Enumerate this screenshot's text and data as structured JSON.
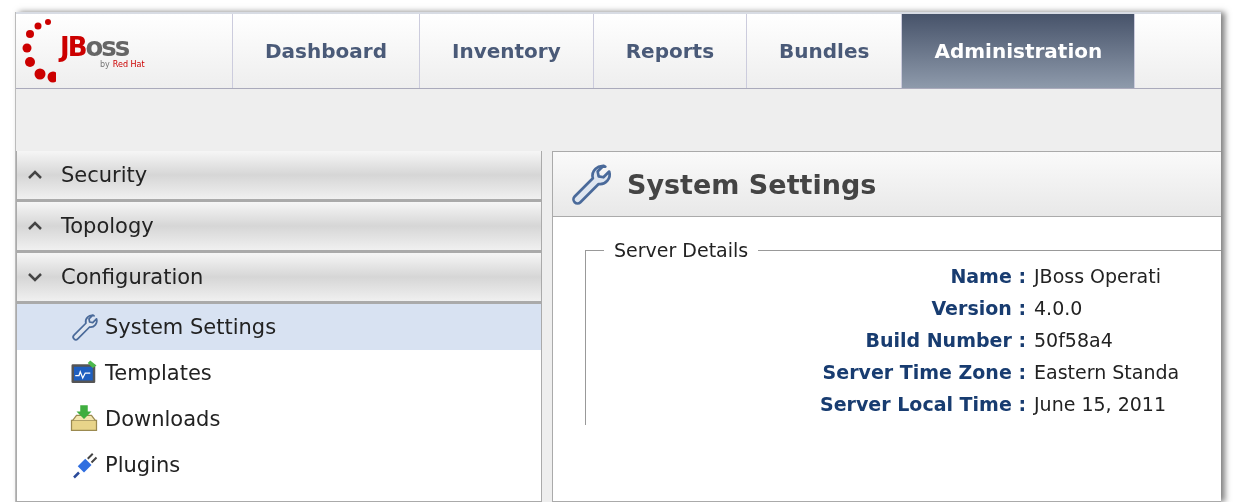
{
  "logo": {
    "name": "JBoss",
    "byline_prefix": "by",
    "byline_brand": "Red Hat"
  },
  "tabs": [
    {
      "label": "Dashboard",
      "selected": false
    },
    {
      "label": "Inventory",
      "selected": false
    },
    {
      "label": "Reports",
      "selected": false
    },
    {
      "label": "Bundles",
      "selected": false
    },
    {
      "label": "Administration",
      "selected": true
    }
  ],
  "sidebar": {
    "sections": [
      {
        "label": "Security",
        "expanded": false
      },
      {
        "label": "Topology",
        "expanded": false
      },
      {
        "label": "Configuration",
        "expanded": true,
        "items": [
          {
            "label": "System Settings",
            "kind": "wrench",
            "selected": true
          },
          {
            "label": "Templates",
            "kind": "monitor",
            "selected": false
          },
          {
            "label": "Downloads",
            "kind": "tray",
            "selected": false
          },
          {
            "label": "Plugins",
            "kind": "plug",
            "selected": false
          }
        ]
      }
    ]
  },
  "panel": {
    "title": "System Settings",
    "fieldset": {
      "legend": "Server Details",
      "rows": [
        {
          "label": "Name :",
          "value": "JBoss Operati"
        },
        {
          "label": "Version :",
          "value": "4.0.0"
        },
        {
          "label": "Build Number :",
          "value": "50f58a4"
        },
        {
          "label": "Server Time Zone :",
          "value": "Eastern Standa"
        },
        {
          "label": "Server Local Time :",
          "value": "June 15, 2011"
        }
      ]
    }
  }
}
